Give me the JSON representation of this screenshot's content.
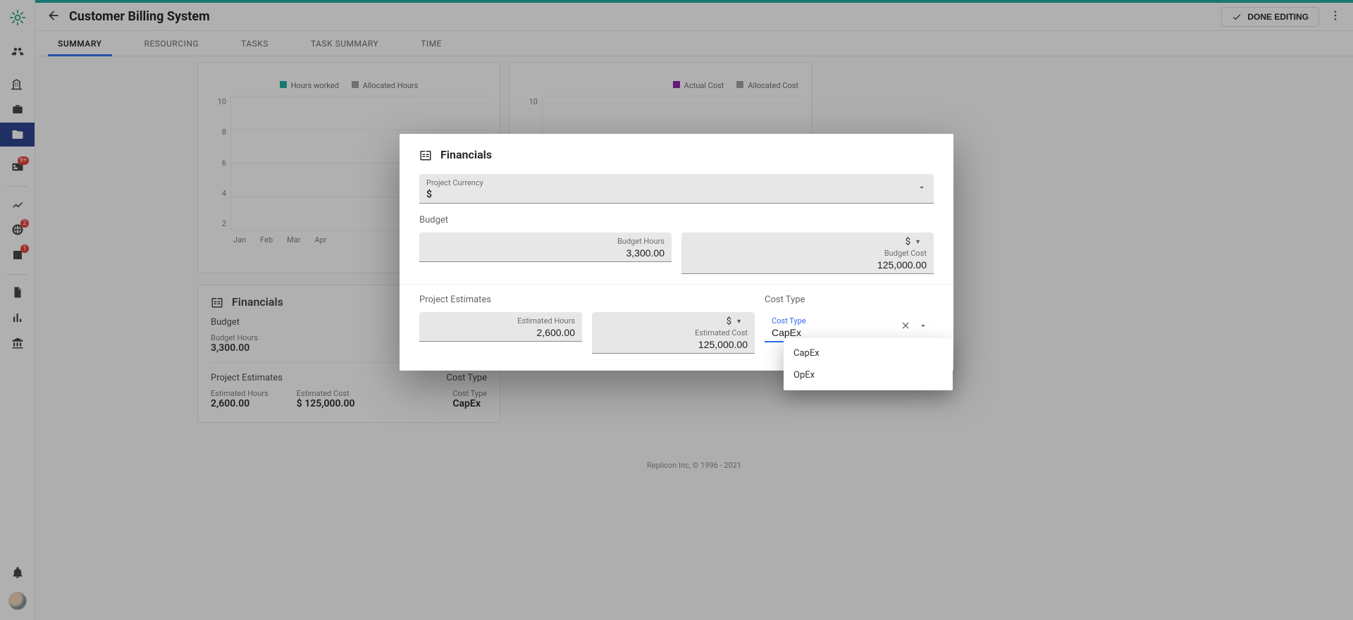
{
  "app": {
    "title": "Customer Billing System",
    "done_label": "DONE EDITING"
  },
  "tabs": {
    "summary": "SUMMARY",
    "resourcing": "RESOURCING",
    "tasks": "TASKS",
    "task_summary": "TASK SUMMARY",
    "time": "TIME",
    "active": "SUMMARY"
  },
  "sidebar": {
    "badges": {
      "card": "9+",
      "globe": "2",
      "stats": "1"
    }
  },
  "charts": {
    "hours": {
      "legend1": "Hours worked",
      "legend1_color": "#1aa9a0",
      "legend2": "Allocated Hours",
      "legend2_color": "#9e9e9e",
      "y_ticks": [
        "10",
        "8",
        "6",
        "4",
        "2"
      ],
      "x_ticks": [
        "Jan",
        "Feb",
        "Mar",
        "Apr"
      ]
    },
    "cost": {
      "legend1": "Actual Cost",
      "legend1_color": "#8a1aa9",
      "legend2": "Allocated Cost",
      "legend2_color": "#9e9e9e",
      "y_ticks": [
        "10"
      ],
      "x_ticks": []
    }
  },
  "chart_data": [
    {
      "type": "line",
      "title": "",
      "xlabel": "",
      "ylabel": "",
      "ylim": [
        0,
        10
      ],
      "categories": [
        "Jan",
        "Feb",
        "Mar",
        "Apr"
      ],
      "series": [
        {
          "name": "Hours worked",
          "values": [
            null,
            null,
            null,
            null
          ]
        },
        {
          "name": "Allocated Hours",
          "values": [
            null,
            null,
            null,
            null
          ]
        }
      ]
    },
    {
      "type": "line",
      "title": "",
      "xlabel": "",
      "ylabel": "",
      "ylim": [
        0,
        10
      ],
      "categories": [],
      "series": [
        {
          "name": "Actual Cost",
          "values": []
        },
        {
          "name": "Allocated Cost",
          "values": []
        }
      ]
    }
  ],
  "financials_card": {
    "title": "Financials",
    "budget_head": "Budget",
    "budget_hours_label": "Budget Hours",
    "budget_hours_value": "3,300.00",
    "divider": true,
    "project_estimates_head": "Project Estimates",
    "cost_type_head": "Cost Type",
    "estimated_hours_label": "Estimated Hours",
    "estimated_hours_value": "2,600.00",
    "estimated_cost_label": "Estimated Cost",
    "estimated_cost_value": "$ 125,000.00",
    "cost_type_label": "Cost Type",
    "cost_type_value": "CapEx"
  },
  "dialog": {
    "title": "Financials",
    "project_currency_label": "Project Currency",
    "project_currency_value": "$",
    "budget_head": "Budget",
    "budget_hours_label": "Budget Hours",
    "budget_hours_value": "3,300.00",
    "budget_cost_label": "Budget Cost",
    "budget_cost_currency": "$",
    "budget_cost_value": "125,000.00",
    "project_estimates_head": "Project Estimates",
    "cost_type_head": "Cost Type",
    "estimated_hours_label": "Estimated Hours",
    "estimated_hours_value": "2,600.00",
    "estimated_cost_label": "Estimated Cost",
    "estimated_cost_currency": "$",
    "estimated_cost_value": "125,000.00",
    "cost_type_label": "Cost Type",
    "cost_type_value": "CapEx"
  },
  "cost_type_menu": {
    "options": [
      "CapEx",
      "OpEx"
    ]
  },
  "footer": "Replicon Inc, © 1996 - 2021"
}
